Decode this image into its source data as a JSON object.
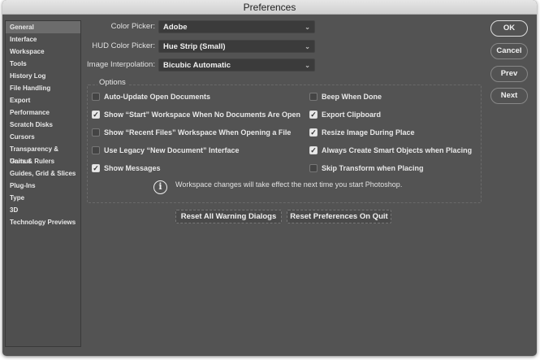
{
  "window": {
    "title": "Preferences"
  },
  "sidebar": {
    "items": [
      {
        "label": "General",
        "selected": true
      },
      {
        "label": "Interface"
      },
      {
        "label": "Workspace"
      },
      {
        "label": "Tools"
      },
      {
        "label": "History Log"
      },
      {
        "label": "File Handling"
      },
      {
        "label": "Export"
      },
      {
        "label": "Performance"
      },
      {
        "label": "Scratch Disks"
      },
      {
        "label": "Cursors"
      },
      {
        "label": "Transparency & Gamut"
      },
      {
        "label": "Units & Rulers"
      },
      {
        "label": "Guides, Grid & Slices"
      },
      {
        "label": "Plug-Ins"
      },
      {
        "label": "Type"
      },
      {
        "label": "3D"
      },
      {
        "label": "Technology Previews"
      }
    ]
  },
  "fields": {
    "color_picker": {
      "label": "Color Picker:",
      "value": "Adobe"
    },
    "hud_color_picker": {
      "label": "HUD Color Picker:",
      "value": "Hue Strip (Small)"
    },
    "image_interpolation": {
      "label": "Image Interpolation:",
      "value": "Bicubic Automatic"
    }
  },
  "options": {
    "label": "Options",
    "left": [
      {
        "label": "Auto-Update Open Documents",
        "checked": false
      },
      {
        "label": "Show “Start” Workspace When No Documents Are Open",
        "checked": true
      },
      {
        "label": "Show “Recent Files” Workspace When Opening a File",
        "checked": false
      },
      {
        "label": "Use Legacy “New Document” Interface",
        "checked": false
      },
      {
        "label": "Show Messages",
        "checked": true
      }
    ],
    "right": [
      {
        "label": "Beep When Done",
        "checked": false
      },
      {
        "label": "Export Clipboard",
        "checked": true
      },
      {
        "label": "Resize Image During Place",
        "checked": true
      },
      {
        "label": "Always Create Smart Objects when Placing",
        "checked": true
      },
      {
        "label": "Skip Transform when Placing",
        "checked": false
      }
    ],
    "info": "Workspace changes will take effect the next time you start Photoshop."
  },
  "buttons": {
    "reset_warnings": "Reset All Warning Dialogs",
    "reset_prefs": "Reset Preferences On Quit",
    "ok": "OK",
    "cancel": "Cancel",
    "prev": "Prev",
    "next": "Next"
  }
}
